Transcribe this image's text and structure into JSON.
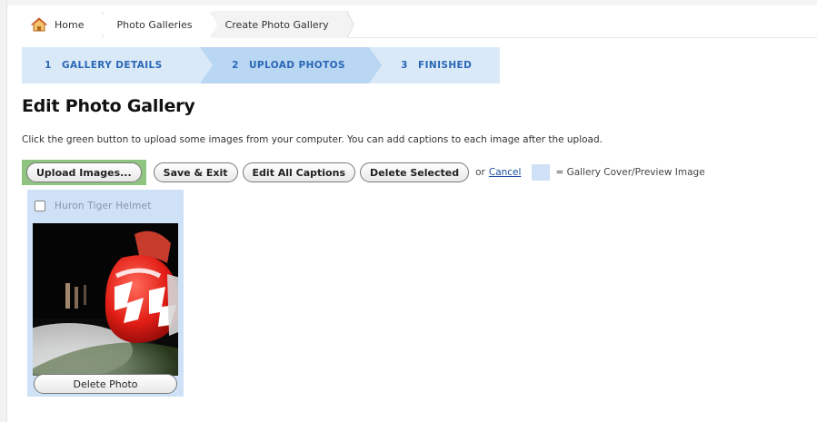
{
  "breadcrumb": {
    "items": [
      {
        "label": "Home",
        "icon": "home-icon"
      },
      {
        "label": "Photo Galleries"
      },
      {
        "label": "Create Photo Gallery"
      }
    ]
  },
  "wizard": {
    "steps": [
      {
        "number": "1",
        "label": "GALLERY DETAILS"
      },
      {
        "number": "2",
        "label": "UPLOAD PHOTOS",
        "active": true
      },
      {
        "number": "3",
        "label": "FINISHED"
      }
    ]
  },
  "page": {
    "title": "Edit Photo Gallery",
    "intro": "Click the green button to upload some images from your computer. You can add captions to each image after the upload."
  },
  "toolbar": {
    "upload_label": "Upload Images...",
    "save_exit_label": "Save & Exit",
    "edit_captions_label": "Edit All Captions",
    "delete_selected_label": "Delete Selected",
    "or_text": "or",
    "cancel_label": "Cancel",
    "legend_text": "= Gallery Cover/Preview Image"
  },
  "photos": [
    {
      "caption": "Huron Tiger Helmet",
      "delete_label": "Delete Photo",
      "checked": false
    }
  ],
  "colors": {
    "accent_blue": "#2a67b5",
    "step_bg": "#d9e9f8",
    "step_active_bg": "#b9d6f3",
    "upload_green": "#8fc481",
    "cover_highlight": "#cfe1f6"
  }
}
